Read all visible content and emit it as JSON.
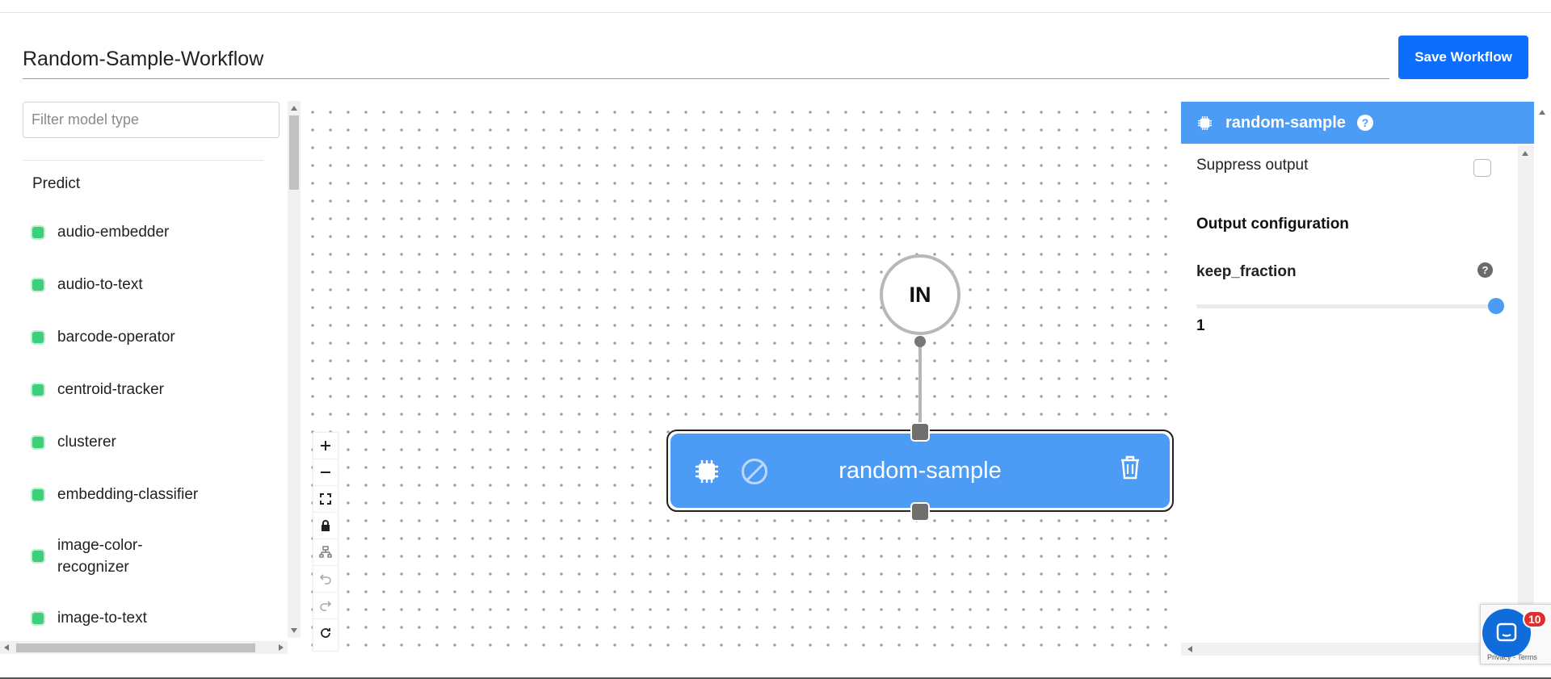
{
  "workflow": {
    "name": "Random-Sample-Workflow",
    "save_label": "Save Workflow"
  },
  "sidebar": {
    "filter_placeholder": "Filter model type",
    "group_label": "Predict",
    "items": [
      {
        "label": "audio-embedder",
        "icon": "chip-icon"
      },
      {
        "label": "audio-to-text",
        "icon": "chip-icon"
      },
      {
        "label": "barcode-operator",
        "icon": "chip-icon"
      },
      {
        "label": "centroid-tracker",
        "icon": "chip-icon"
      },
      {
        "label": "clusterer",
        "icon": "chip-icon"
      },
      {
        "label": "embedding-classifier",
        "icon": "chip-icon"
      },
      {
        "label": "image-color-recognizer",
        "icon": "chip-icon"
      },
      {
        "label": "image-to-text",
        "icon": "chip-icon"
      }
    ]
  },
  "canvas": {
    "controls": [
      "zoom-in",
      "zoom-out",
      "fit-view",
      "lock",
      "auto-layout",
      "undo",
      "redo",
      "reset"
    ],
    "input_node_label": "IN",
    "model_node_label": "random-sample",
    "node_color": "#4c9bf5"
  },
  "config_panel": {
    "title": "random-sample",
    "help_glyph": "?",
    "suppress_output_label": "Suppress output",
    "suppress_output_checked": false,
    "output_heading": "Output configuration",
    "param_name": "keep_fraction",
    "param_value": "1",
    "param_fraction": 1.0
  },
  "chat": {
    "badge_count": "10",
    "recaptcha_text": "Privacy - Terms"
  },
  "colors": {
    "primary_button": "#0d6efd",
    "accent": "#4c9bf5",
    "model_icon": "#3ecf7b",
    "badge": "#e02d2d"
  }
}
